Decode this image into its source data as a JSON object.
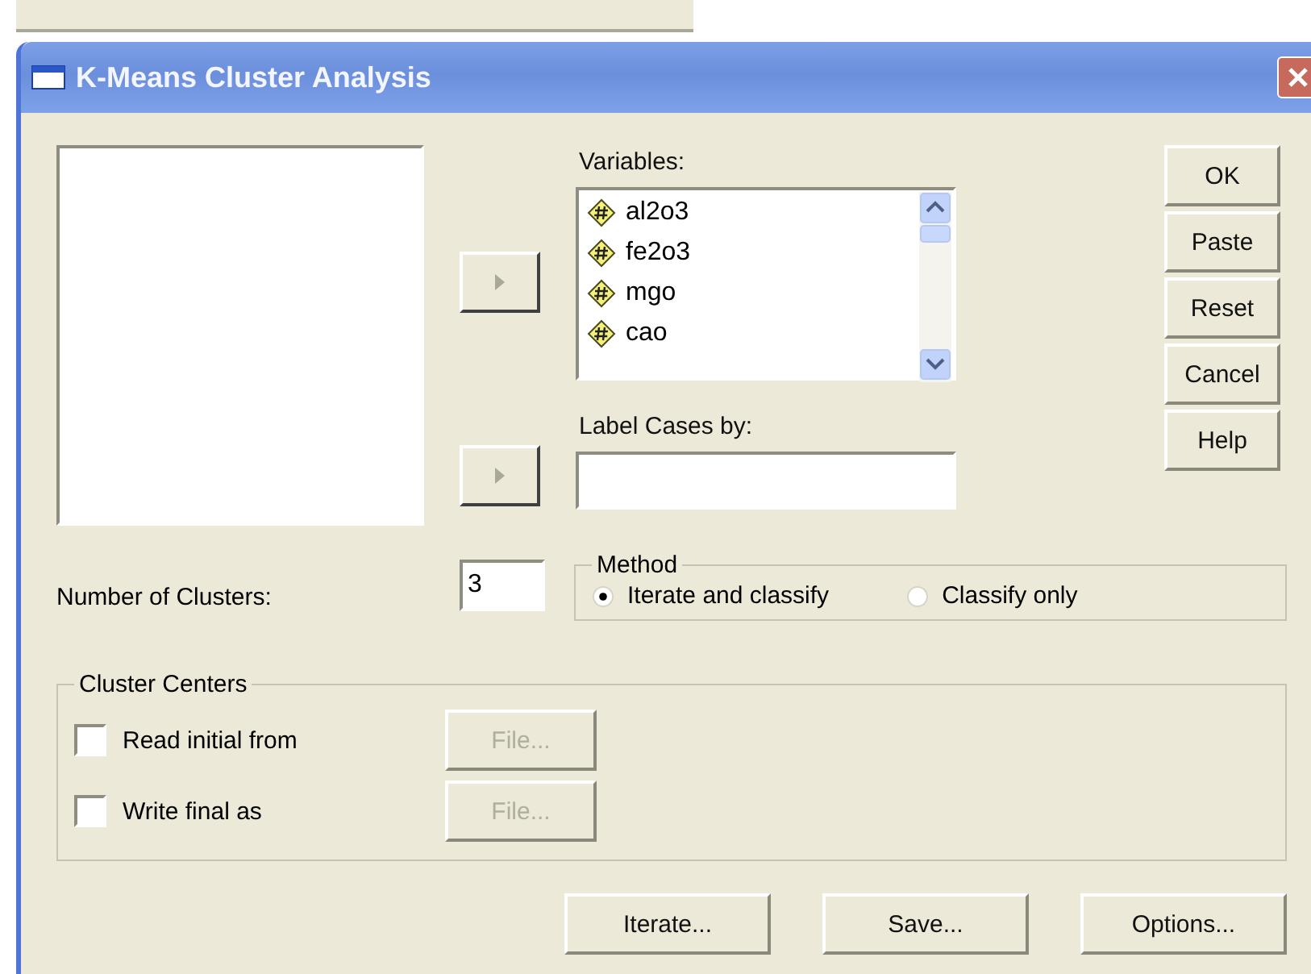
{
  "window": {
    "title": "K-Means Cluster Analysis"
  },
  "arrow_buttons": [
    {
      "disabled": true
    },
    {
      "disabled": true
    }
  ],
  "variables": {
    "label": "Variables:",
    "items": [
      {
        "name": "al2o3"
      },
      {
        "name": "fe2o3"
      },
      {
        "name": "mgo"
      },
      {
        "name": "cao"
      }
    ]
  },
  "label_cases": {
    "label": "Label Cases by:"
  },
  "side_buttons": [
    "OK",
    "Paste",
    "Reset",
    "Cancel",
    "Help"
  ],
  "number_of_clusters": {
    "label": "Number of Clusters:",
    "value": "3"
  },
  "method": {
    "title": "Method",
    "options": [
      {
        "label": "Iterate and classify",
        "selected": true
      },
      {
        "label": "Classify only",
        "selected": false
      }
    ]
  },
  "cluster_centers": {
    "title": "Cluster Centers",
    "rows": [
      {
        "label": "Read initial from",
        "checked": false,
        "button": "File...",
        "disabled": true
      },
      {
        "label": "Write final as",
        "checked": false,
        "button": "File...",
        "disabled": true
      }
    ]
  },
  "bottom_buttons": [
    "Iterate...",
    "Save...",
    "Options..."
  ]
}
